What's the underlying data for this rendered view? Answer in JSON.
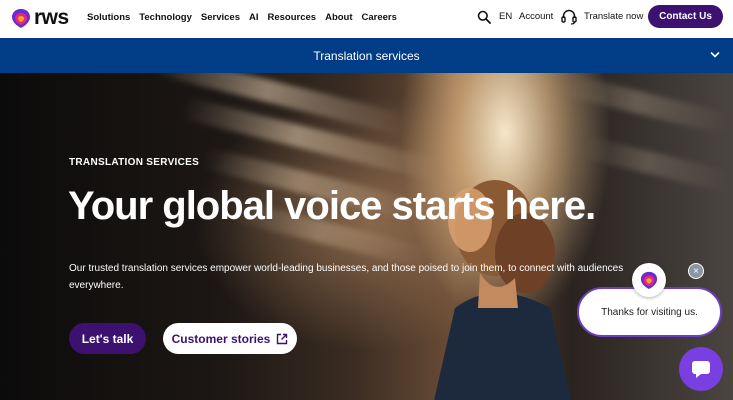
{
  "header": {
    "logo_text": "rws",
    "nav": [
      "Solutions",
      "Technology",
      "Services",
      "AI",
      "Resources",
      "About",
      "Careers"
    ],
    "language": "EN",
    "account": "Account",
    "translate_now": "Translate now",
    "contact": "Contact Us"
  },
  "subbar": {
    "label": "Translation services"
  },
  "hero": {
    "eyebrow": "TRANSLATION SERVICES",
    "title": "Your global voice starts here.",
    "description": "Our trusted translation services empower world-leading businesses, and those poised to join them, to connect with audiences everywhere.",
    "primary_button": "Let's talk",
    "secondary_button": "Customer stories"
  },
  "chat": {
    "message": "Thanks for visiting us.",
    "close": "×"
  },
  "colors": {
    "brand_purple": "#3d1170",
    "subbar_blue": "#003d86",
    "chat_purple": "#7a3fe0"
  }
}
